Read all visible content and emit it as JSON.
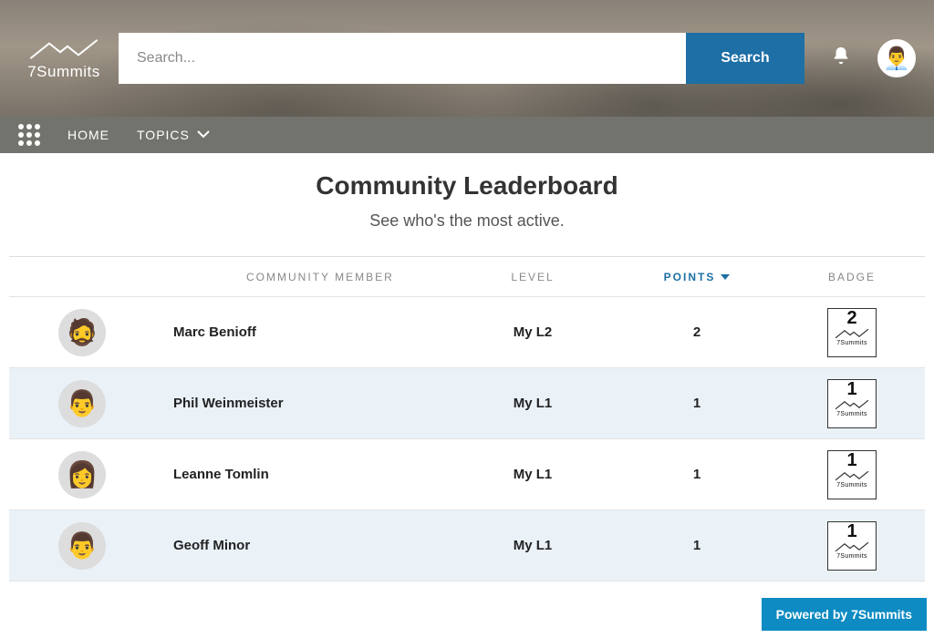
{
  "brand": {
    "name": "7Summits"
  },
  "search": {
    "placeholder": "Search...",
    "button": "Search"
  },
  "nav": {
    "home": "HOME",
    "topics": "TOPICS"
  },
  "page": {
    "title": "Community Leaderboard",
    "subtitle": "See who's the most active."
  },
  "table": {
    "headers": {
      "member": "COMMUNITY MEMBER",
      "level": "LEVEL",
      "points": "POINTS",
      "badge": "BADGE"
    },
    "sort": {
      "column": "POINTS",
      "direction": "desc"
    },
    "rows": [
      {
        "name": "Marc Benioff",
        "level": "My L2",
        "points": "2",
        "badge_num": "2",
        "badge_txt": "7Summits"
      },
      {
        "name": "Phil Weinmeister",
        "level": "My L1",
        "points": "1",
        "badge_num": "1",
        "badge_txt": "7Summits"
      },
      {
        "name": "Leanne Tomlin",
        "level": "My L1",
        "points": "1",
        "badge_num": "1",
        "badge_txt": "7Summits"
      },
      {
        "name": "Geoff Minor",
        "level": "My L1",
        "points": "1",
        "badge_num": "1",
        "badge_txt": "7Summits"
      }
    ]
  },
  "footer": {
    "powered": "Powered by 7Summits"
  },
  "avatars": {
    "header": "👨‍💼",
    "rows": [
      "🧔",
      "👨",
      "👩",
      "👨"
    ]
  }
}
